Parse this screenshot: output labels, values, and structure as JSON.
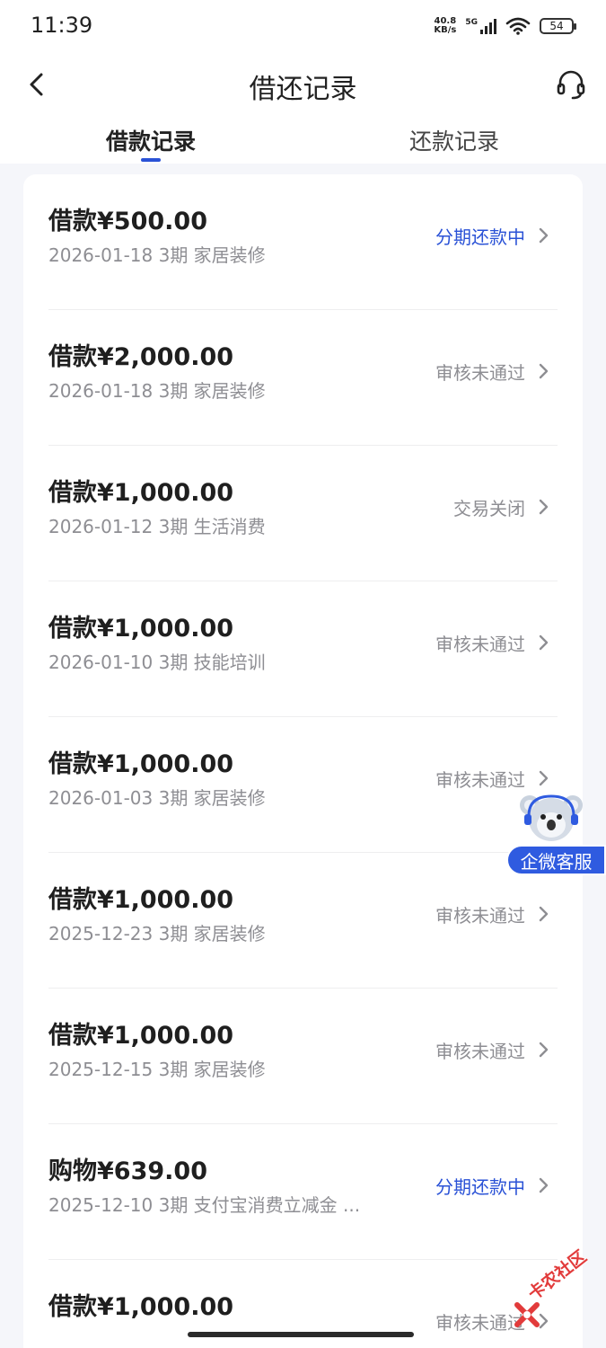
{
  "status_bar": {
    "time": "11:39",
    "net_speed_value": "40.8",
    "net_speed_unit": "KB/s",
    "network_type": "5G",
    "battery": "54"
  },
  "nav": {
    "title": "借还记录",
    "back_icon": "chevron-left-icon",
    "service_icon": "headset-icon"
  },
  "tabs": [
    {
      "label": "借款记录",
      "active": true
    },
    {
      "label": "还款记录",
      "active": false
    }
  ],
  "records": [
    {
      "amount": "借款¥500.00",
      "meta": "2026-01-18 3期  家居装修",
      "status": "分期还款中",
      "status_color": "#2a52d6"
    },
    {
      "amount": "借款¥2,000.00",
      "meta": "2026-01-18 3期  家居装修",
      "status": "审核未通过",
      "status_color": "#8e8e93"
    },
    {
      "amount": "借款¥1,000.00",
      "meta": "2026-01-12 3期  生活消费",
      "status": "交易关闭",
      "status_color": "#8e8e93"
    },
    {
      "amount": "借款¥1,000.00",
      "meta": "2026-01-10 3期  技能培训",
      "status": "审核未通过",
      "status_color": "#8e8e93"
    },
    {
      "amount": "借款¥1,000.00",
      "meta": "2026-01-03 3期  家居装修",
      "status": "审核未通过",
      "status_color": "#8e8e93"
    },
    {
      "amount": "借款¥1,000.00",
      "meta": "2025-12-23 3期  家居装修",
      "status": "审核未通过",
      "status_color": "#8e8e93"
    },
    {
      "amount": "借款¥1,000.00",
      "meta": "2025-12-15 3期  家居装修",
      "status": "审核未通过",
      "status_color": "#8e8e93"
    },
    {
      "amount": "购物¥639.00",
      "meta": "2025-12-10 3期  支付宝消费立减金 ...",
      "status": "分期还款中",
      "status_color": "#2a52d6"
    },
    {
      "amount": "借款¥1,000.00",
      "meta": "",
      "status": "审核未通过",
      "status_color": "#8e8e93"
    }
  ],
  "float_service": {
    "label": "企微客服",
    "icon": "koala-mascot-icon"
  },
  "watermark": {
    "text": "卡农社区"
  },
  "colors": {
    "accent": "#2a52d6",
    "float_bg": "#2f5be0",
    "muted": "#8e8e93"
  }
}
